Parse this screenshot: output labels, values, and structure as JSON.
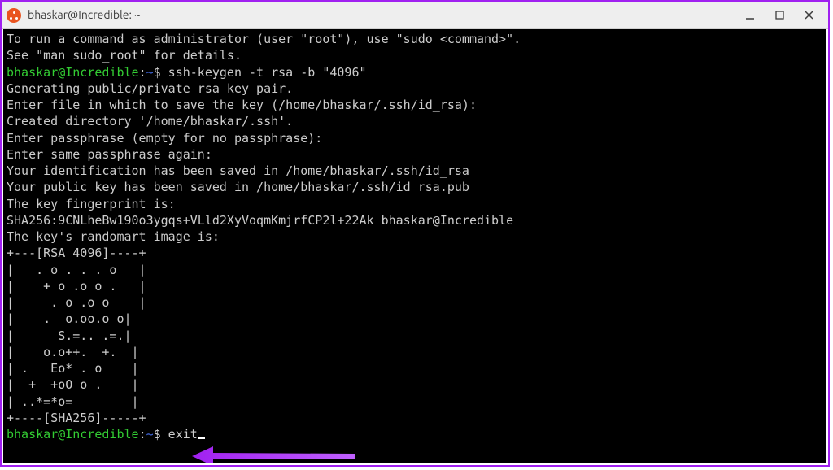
{
  "window": {
    "title": "bhaskar@Incredible: ~"
  },
  "prompt": {
    "user": "bhaskar@Incredible",
    "separator": ":",
    "path": "~",
    "sigil": "$"
  },
  "commands": {
    "keygen": " ssh-keygen -t rsa -b \"4096\"",
    "exit": " exit"
  },
  "output": {
    "l01": "To run a command as administrator (user \"root\"), use \"sudo <command>\".",
    "l02": "See \"man sudo_root\" for details.",
    "l03": "",
    "l04": "Generating public/private rsa key pair.",
    "l05": "Enter file in which to save the key (/home/bhaskar/.ssh/id_rsa):",
    "l06": "Created directory '/home/bhaskar/.ssh'.",
    "l07": "Enter passphrase (empty for no passphrase):",
    "l08": "Enter same passphrase again:",
    "l09": "Your identification has been saved in /home/bhaskar/.ssh/id_rsa",
    "l10": "Your public key has been saved in /home/bhaskar/.ssh/id_rsa.pub",
    "l11": "The key fingerprint is:",
    "l12": "SHA256:9CNLheBw190o3ygqs+VLld2XyVoqmKmjrfCP2l+22Ak bhaskar@Incredible",
    "l13": "The key's randomart image is:",
    "r01": "+---[RSA 4096]----+",
    "r02": "|   . o . . . o   |",
    "r03": "|    + o .o o .   |",
    "r04": "|     . o .o o    |",
    "r05": "|    .  o.oo.o o| ",
    "r06": "|      S.=.. .=.| ",
    "r07": "|    o.o++.  +.  |",
    "r08": "| .   Eo* . o    |",
    "r09": "|  +  +oO o .    |",
    "r10": "| ..*=*o=        |",
    "r11": "+----[SHA256]-----+"
  },
  "colors": {
    "accent_border": "#a020f0",
    "terminal_bg": "#000000",
    "terminal_fg": "#cccccc",
    "prompt_user": "#33cc33",
    "prompt_path": "#4169e1",
    "arrow": "#a020f0"
  }
}
